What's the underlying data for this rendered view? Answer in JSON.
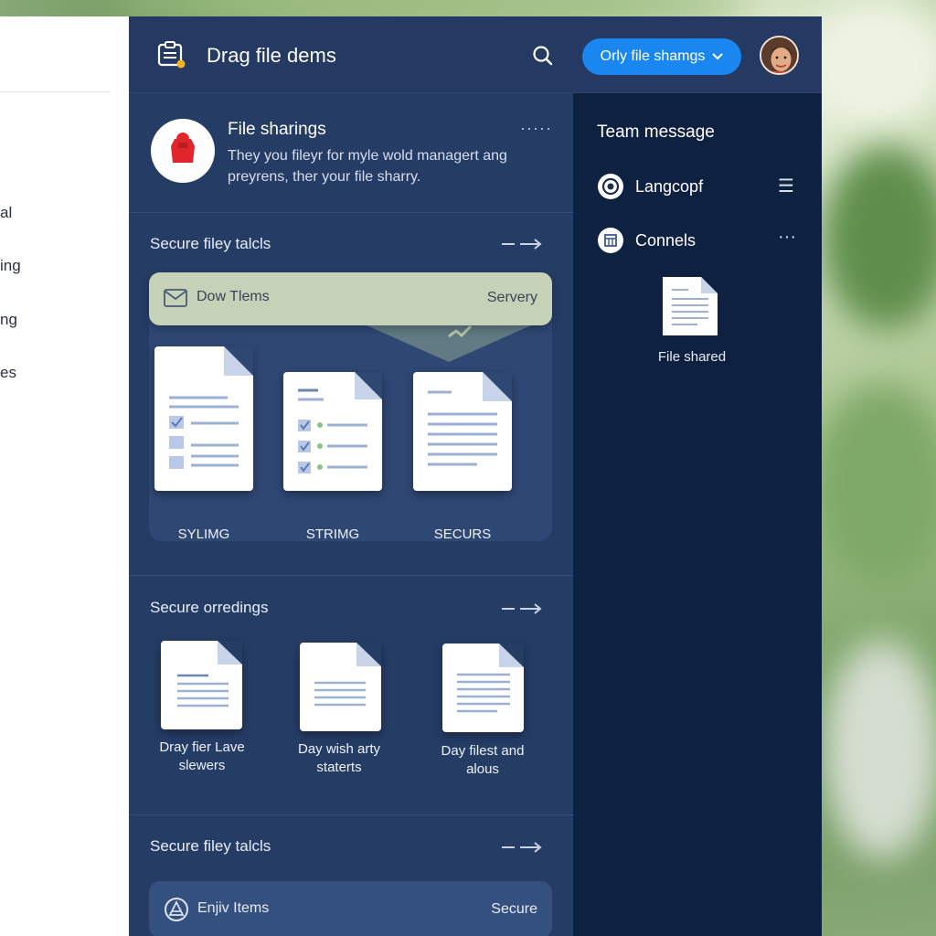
{
  "sidebar_left": {
    "items": [
      "al",
      "ing",
      "ng",
      "es"
    ]
  },
  "header": {
    "title": "Drag file dems",
    "share_button_label": "Orly file shamgs",
    "icons": {
      "app": "clipboard-icon",
      "search": "search-icon",
      "dropdown": "chevron-down-icon"
    }
  },
  "file_sharing_card": {
    "title": "File sharings",
    "description": "They you fileyr for myle wold managert ang preyrens, ther your file sharry.",
    "more": "·····"
  },
  "section1": {
    "title": "Secure filey talcls",
    "banner_left": "Dow Tlems",
    "banner_right": "Servery",
    "docs": [
      {
        "label": "SYLIMG"
      },
      {
        "label": "STRIMG"
      },
      {
        "label": "SECURS"
      }
    ]
  },
  "section2": {
    "title": "Secure orredings",
    "docs": [
      {
        "line1": "Dray fier Lave",
        "line2": "slewers"
      },
      {
        "line1": "Day wish arty",
        "line2": "staterts"
      },
      {
        "line1": "Day filest and",
        "line2": "alous"
      }
    ]
  },
  "section3": {
    "title": "Secure filey talcls",
    "row_left": "Enjiv Items",
    "row_right": "Secure"
  },
  "team_panel": {
    "title": "Team message",
    "contacts": [
      {
        "name": "Langcopf",
        "action": "☰"
      },
      {
        "name": "Connels",
        "action": "···"
      }
    ],
    "shared_label": "File shared"
  },
  "colors": {
    "window_bg": "#22375e",
    "right_panel_bg": "#0f2141",
    "accent_button": "#1a86f0",
    "banner_bg": "#c5d2b8",
    "badge_red": "#e0262b"
  }
}
